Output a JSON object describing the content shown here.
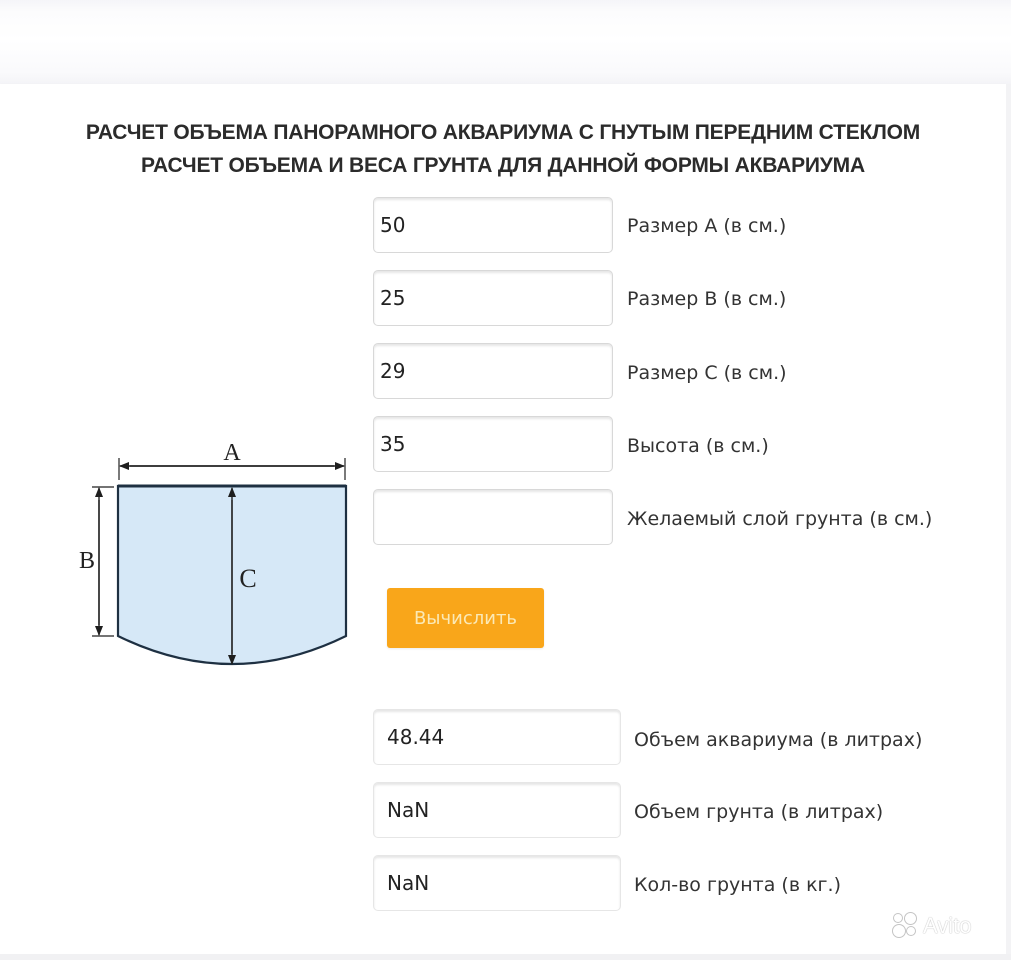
{
  "header": {
    "title_line1": "РАСЧЕТ ОБЪЕМА ПАНОРАМНОГО АКВАРИУМА С ГНУТЫМ ПЕРЕДНИМ СТЕКЛОМ",
    "title_line2": "РАСЧЕТ ОБЪЕМА И ВЕСА ГРУНТА ДЛЯ ДАННОЙ ФОРМЫ АКВАРИУМА"
  },
  "diagram": {
    "label_a": "A",
    "label_b": "B",
    "label_c": "C",
    "fill_color": "#d6e8f7",
    "stroke_color": "#1e3042"
  },
  "inputs": [
    {
      "value": "50",
      "label": "Размер A (в см.)"
    },
    {
      "value": "25",
      "label": "Размер B (в см.)"
    },
    {
      "value": "29",
      "label": "Размер C (в см.)"
    },
    {
      "value": "35",
      "label": "Высота (в см.)"
    },
    {
      "value": "",
      "label": "Желаемый слой грунта (в см.)"
    }
  ],
  "calculate_button": {
    "label": "Вычислить",
    "color": "#f9a61a"
  },
  "outputs": [
    {
      "value": "48.44",
      "label": "Объем аквариума (в литрах)"
    },
    {
      "value": "NaN",
      "label": "Объем грунта (в литрах)"
    },
    {
      "value": "NaN",
      "label": "Кол-во грунта (в кг.)"
    }
  ],
  "watermark": {
    "text": "Avito"
  }
}
